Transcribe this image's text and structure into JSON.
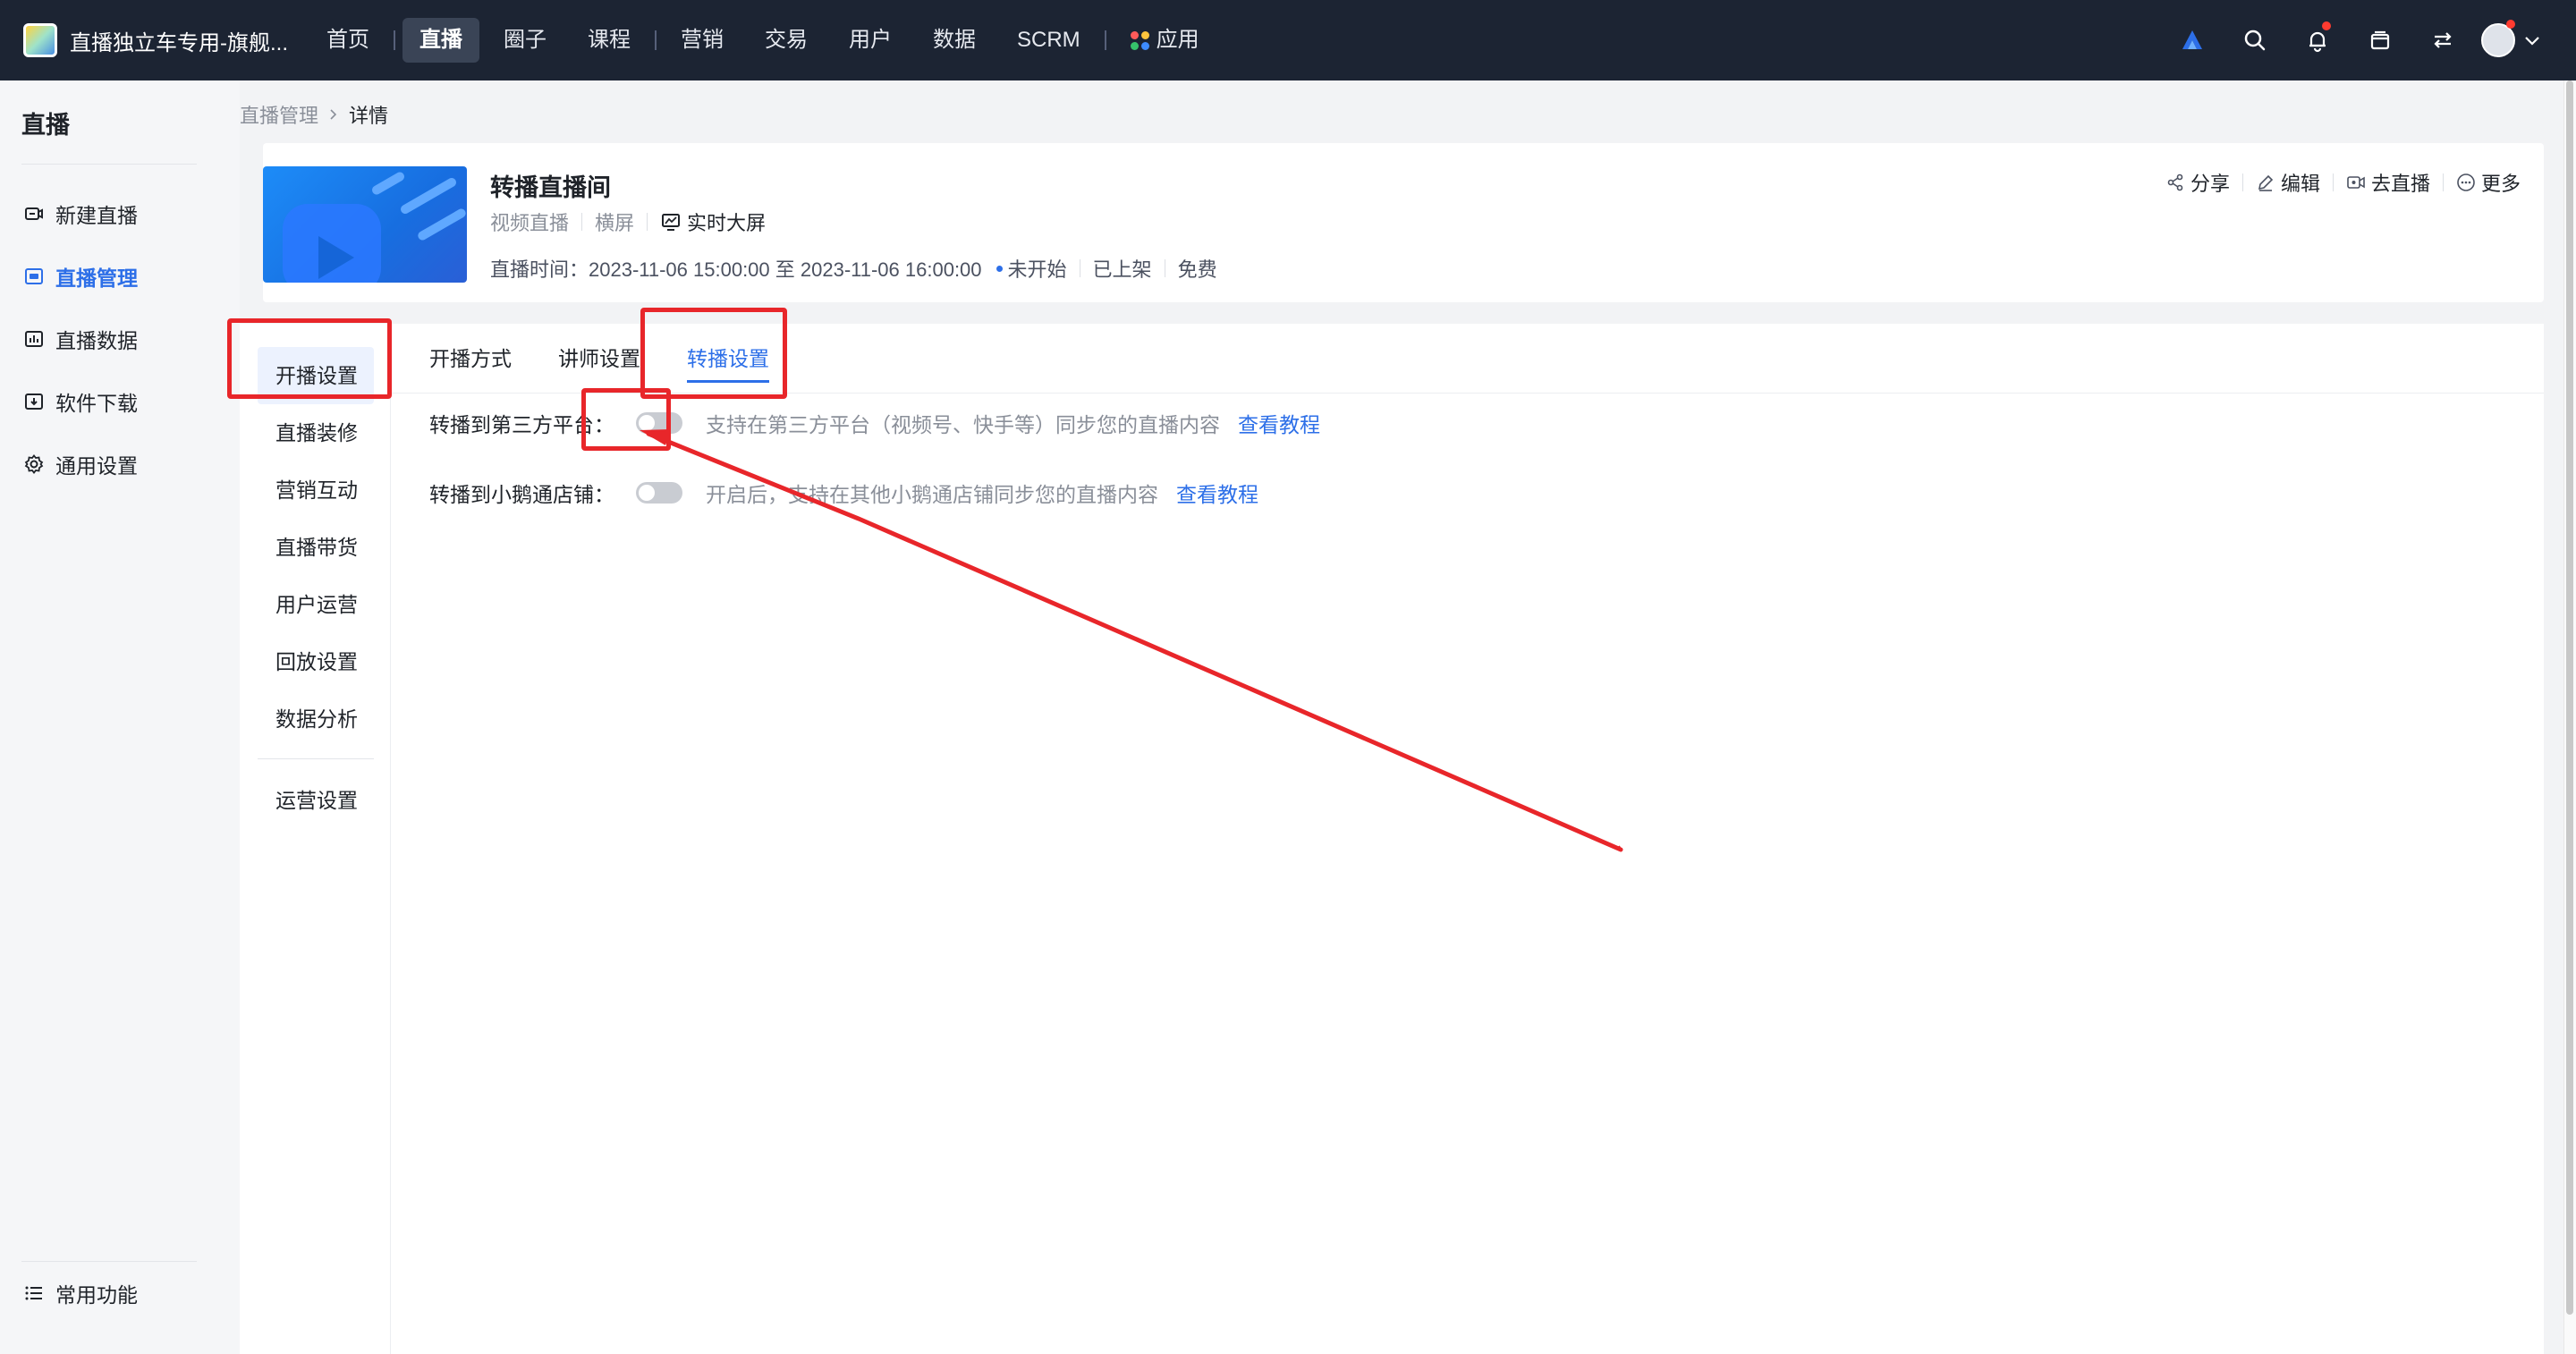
{
  "topbar": {
    "brand_name": "直播独立车专用-旗舰...",
    "nav_items": [
      "首页",
      "直播",
      "圈子",
      "课程",
      "营销",
      "交易",
      "用户",
      "数据",
      "SCRM",
      "应用"
    ],
    "active_nav": "直播"
  },
  "sidebar": {
    "title": "直播",
    "items": [
      {
        "label": "新建直播",
        "icon": "new-live-icon"
      },
      {
        "label": "直播管理",
        "icon": "live-manage-icon"
      },
      {
        "label": "直播数据",
        "icon": "live-data-icon"
      },
      {
        "label": "软件下载",
        "icon": "download-icon"
      },
      {
        "label": "通用设置",
        "icon": "gear-icon"
      }
    ],
    "bottom_label": "常用功能"
  },
  "breadcrumb": {
    "parent": "直播管理",
    "current": "详情"
  },
  "live": {
    "title": "转播直播间",
    "type": "视频直播",
    "orientation": "横屏",
    "screen_label": "实时大屏",
    "time_text": "直播时间：2023-11-06 15:00:00 至 2023-11-06 16:00:00",
    "status": "未开始",
    "shelf": "已上架",
    "price": "免费"
  },
  "actions": {
    "share": "分享",
    "edit": "编辑",
    "go_live": "去直播",
    "more": "更多"
  },
  "sub_nav": [
    "开播设置",
    "直播装修",
    "营销互动",
    "直播带货",
    "用户运营",
    "回放设置",
    "数据分析"
  ],
  "sub_nav_bottom": "运营设置",
  "tabs": [
    "开播方式",
    "讲师设置",
    "转播设置"
  ],
  "settings": [
    {
      "label": "转播到第三方平台：",
      "enabled": false,
      "hint": "支持在第三方平台（视频号、快手等）同步您的直播内容",
      "link": "查看教程"
    },
    {
      "label": "转播到小鹅通店铺：",
      "enabled": false,
      "hint": "开启后，支持在其他小鹅通店铺同步您的直播内容",
      "link": "查看教程"
    }
  ],
  "colors": {
    "accent": "#2d6fe8",
    "annotation": "#e8262a",
    "topbar": "#1c2433"
  }
}
